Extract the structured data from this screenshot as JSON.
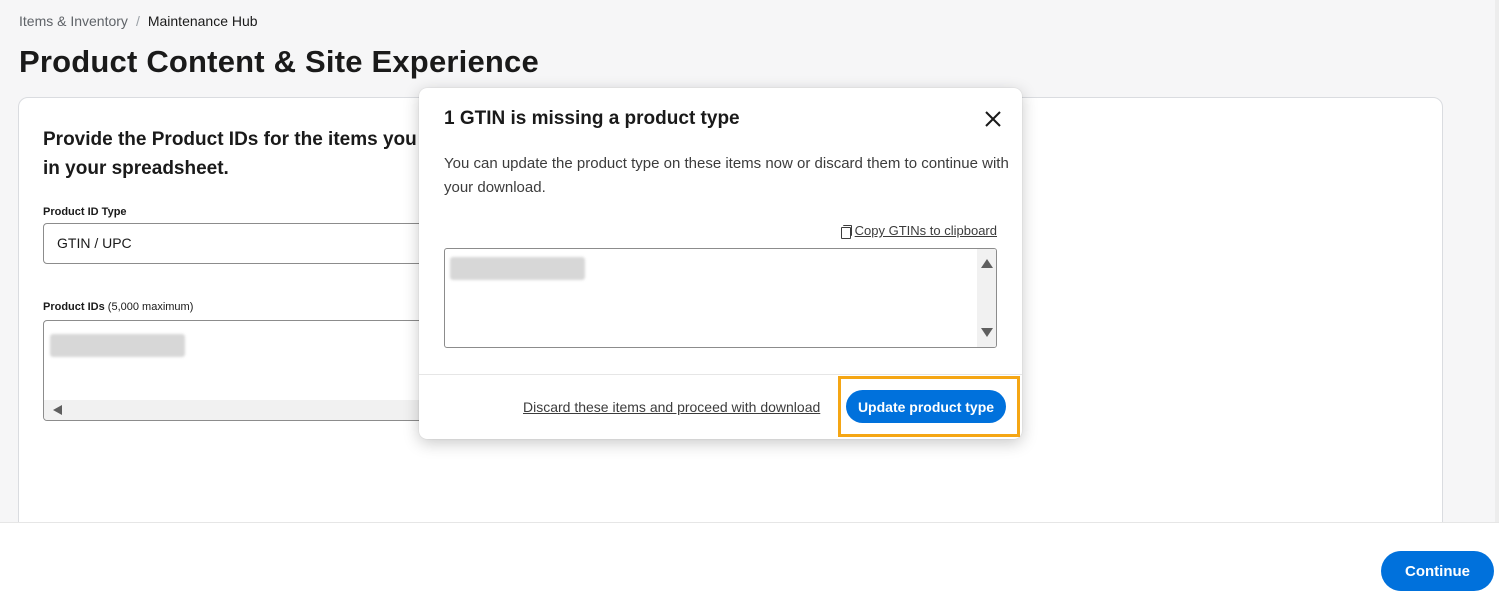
{
  "breadcrumb": {
    "parent": "Items & Inventory",
    "separator": "/",
    "current": "Maintenance Hub"
  },
  "page": {
    "title": "Product Content & Site Experience"
  },
  "card": {
    "heading": "Provide the Product IDs for the items you v in your spreadsheet.",
    "product_id_type_label": "Product ID Type",
    "product_id_type_value": "GTIN / UPC",
    "product_ids_label": "Product IDs",
    "product_ids_hint": "(5,000 maximum)"
  },
  "modal": {
    "title": "1 GTIN is missing a product type",
    "body": "You can update the product type on these items now or discard them to continue with your download.",
    "copy_link": "Copy GTINs to clipboard",
    "discard_link": "Discard these items and proceed with download",
    "update_button": "Update product type"
  },
  "footer": {
    "continue_button": "Continue"
  },
  "colors": {
    "primary": "#0071dc",
    "highlight": "#f5a614"
  },
  "icons": [
    "close-icon",
    "copy-icon",
    "scroll-up-icon",
    "scroll-down-icon",
    "scroll-left-icon"
  ]
}
